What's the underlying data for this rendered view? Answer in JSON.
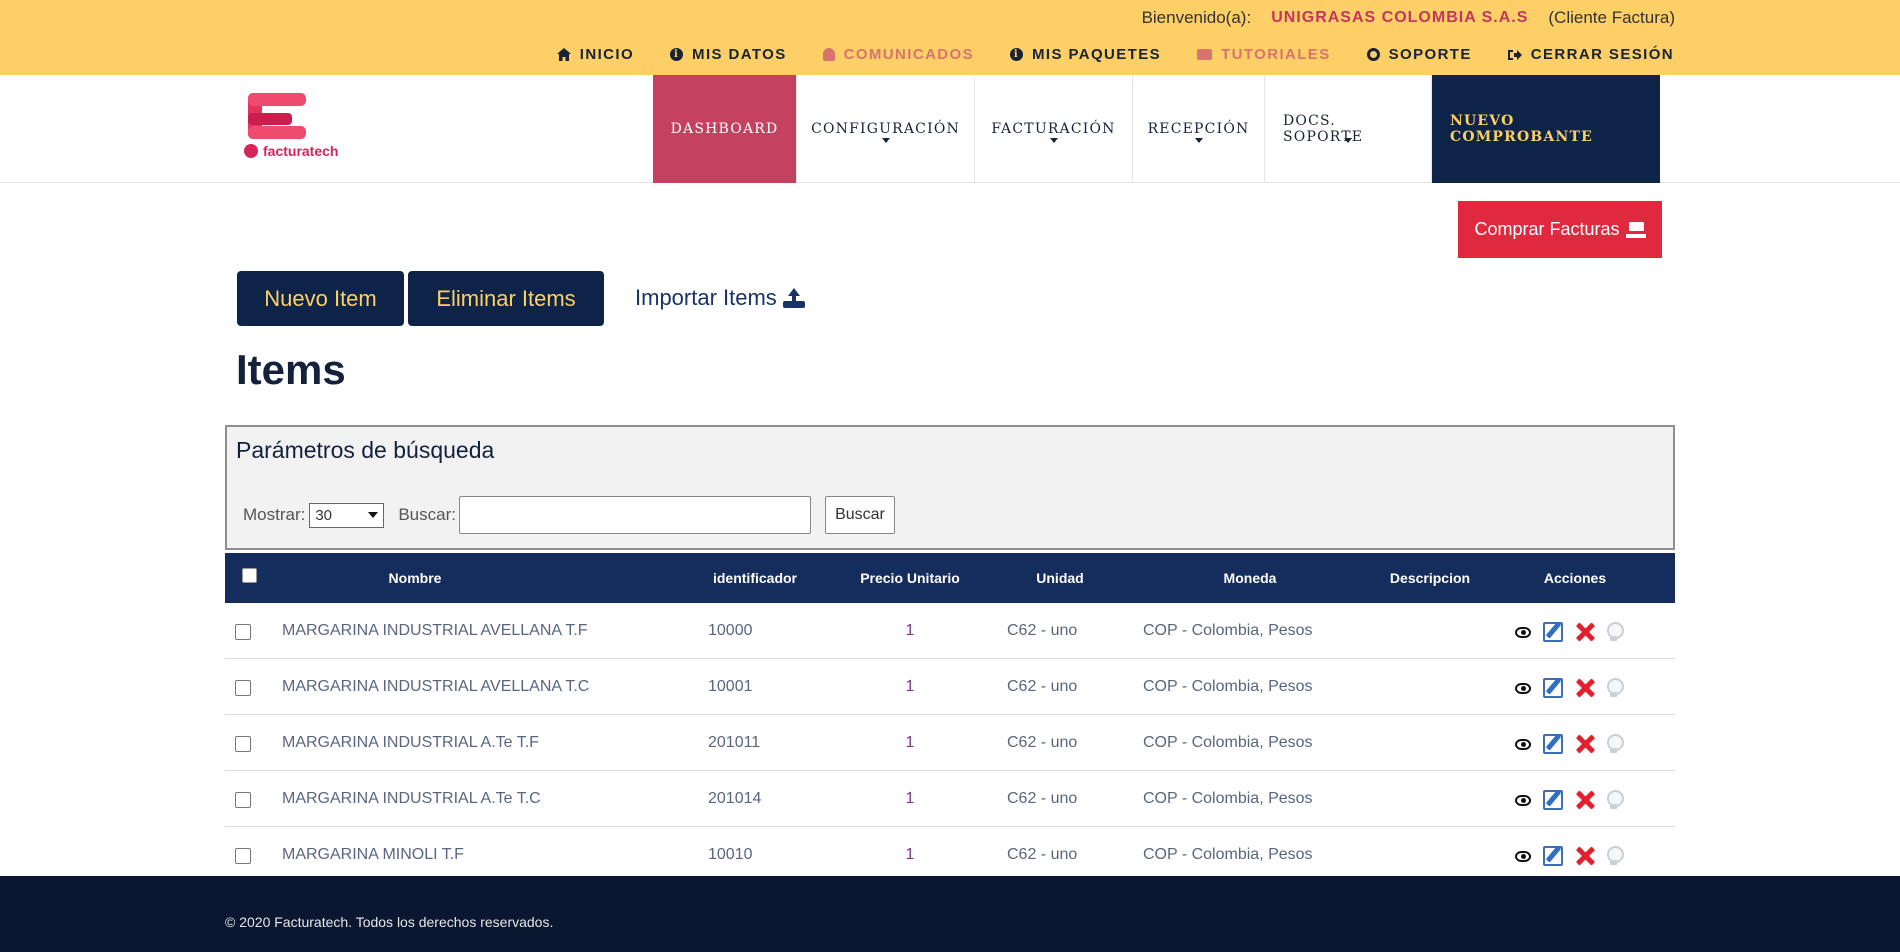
{
  "topbar": {
    "welcome_label": "Bienvenido(a):",
    "company": "UNIGRASAS COLOMBIA S.A.S",
    "role": "(Cliente Factura)",
    "nav": [
      {
        "label": "INICIO",
        "icon": "home-icon"
      },
      {
        "label": "MIS DATOS",
        "icon": "info-icon"
      },
      {
        "label": "COMUNICADOS",
        "icon": "bell-icon"
      },
      {
        "label": "MIS PAQUETES",
        "icon": "info-icon"
      },
      {
        "label": "TUTORIALES",
        "icon": "video-camera-icon"
      },
      {
        "label": "SOPORTE",
        "icon": "life-ring-icon"
      },
      {
        "label": "CERRAR SESIÓN",
        "icon": "sign-out-icon"
      }
    ]
  },
  "brand": {
    "name": "facturatech",
    "color": "#d6235a"
  },
  "mainnav": {
    "dashboard": "DASHBOARD",
    "configuracion": "CONFIGURACIÓN",
    "facturacion": "FACTURACIÓN",
    "recepcion": "RECEPCIÓN",
    "docs_soporte": "DOCS. SOPORTE",
    "nuevo": "NUEVO COMPROBANTE"
  },
  "actions": {
    "comprar": "Comprar Facturas",
    "nuevo_item": "Nuevo Item",
    "eliminar_items": "Eliminar Items",
    "importar_items": "Importar Items"
  },
  "page": {
    "title": "Items"
  },
  "search": {
    "title": "Parámetros de búsqueda",
    "mostrar_label": "Mostrar:",
    "mostrar_value": "30",
    "buscar_label": "Buscar:",
    "buscar_value": "",
    "buscar_button": "Buscar"
  },
  "table": {
    "headers": {
      "nombre": "Nombre",
      "identificador": "identificador",
      "precio": "Precio Unitario",
      "unidad": "Unidad",
      "moneda": "Moneda",
      "descripcion": "Descripcion",
      "acciones": "Acciones"
    },
    "rows": [
      {
        "nombre": "MARGARINA INDUSTRIAL AVELLANA T.F",
        "identificador": "10000",
        "precio": "1",
        "unidad": "C62 - uno",
        "moneda": "COP - Colombia, Pesos",
        "descripcion": ""
      },
      {
        "nombre": "MARGARINA INDUSTRIAL AVELLANA T.C",
        "identificador": "10001",
        "precio": "1",
        "unidad": "C62 - uno",
        "moneda": "COP - Colombia, Pesos",
        "descripcion": ""
      },
      {
        "nombre": "MARGARINA INDUSTRIAL A.Te T.F",
        "identificador": "201011",
        "precio": "1",
        "unidad": "C62 - uno",
        "moneda": "COP - Colombia, Pesos",
        "descripcion": ""
      },
      {
        "nombre": "MARGARINA INDUSTRIAL A.Te T.C",
        "identificador": "201014",
        "precio": "1",
        "unidad": "C62 - uno",
        "moneda": "COP - Colombia, Pesos",
        "descripcion": ""
      },
      {
        "nombre": "MARGARINA MINOLI T.F",
        "identificador": "10010",
        "precio": "1",
        "unidad": "C62 - uno",
        "moneda": "COP - Colombia, Pesos",
        "descripcion": ""
      }
    ]
  },
  "footer": {
    "copyright": "© 2020 Facturatech. Todos los derechos reservados."
  }
}
